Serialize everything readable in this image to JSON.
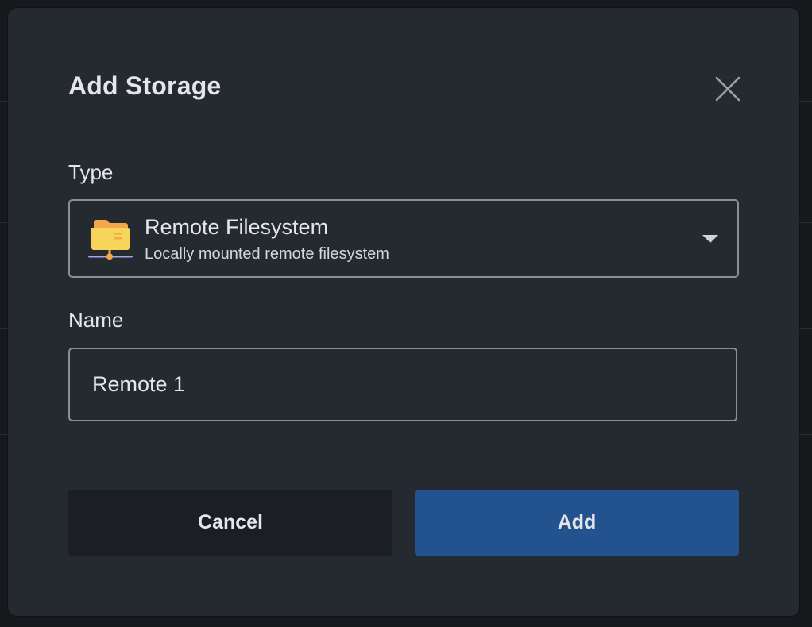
{
  "dialog": {
    "title": "Add Storage",
    "close_icon": "close-icon"
  },
  "type_field": {
    "label": "Type",
    "selected": {
      "icon": "network-folder-icon",
      "title": "Remote Filesystem",
      "subtitle": "Locally mounted remote filesystem"
    },
    "chevron_icon": "chevron-down-icon"
  },
  "name_field": {
    "label": "Name",
    "value": "Remote 1"
  },
  "actions": {
    "cancel_label": "Cancel",
    "add_label": "Add"
  },
  "colors": {
    "dialog_bg": "#252a31",
    "primary": "#23538f",
    "secondary": "#1b1e24",
    "text": "#e4e6ea",
    "folder_yellow": "#f7d45a",
    "folder_orange": "#f3a64a",
    "network_line": "#a9a4e6"
  }
}
